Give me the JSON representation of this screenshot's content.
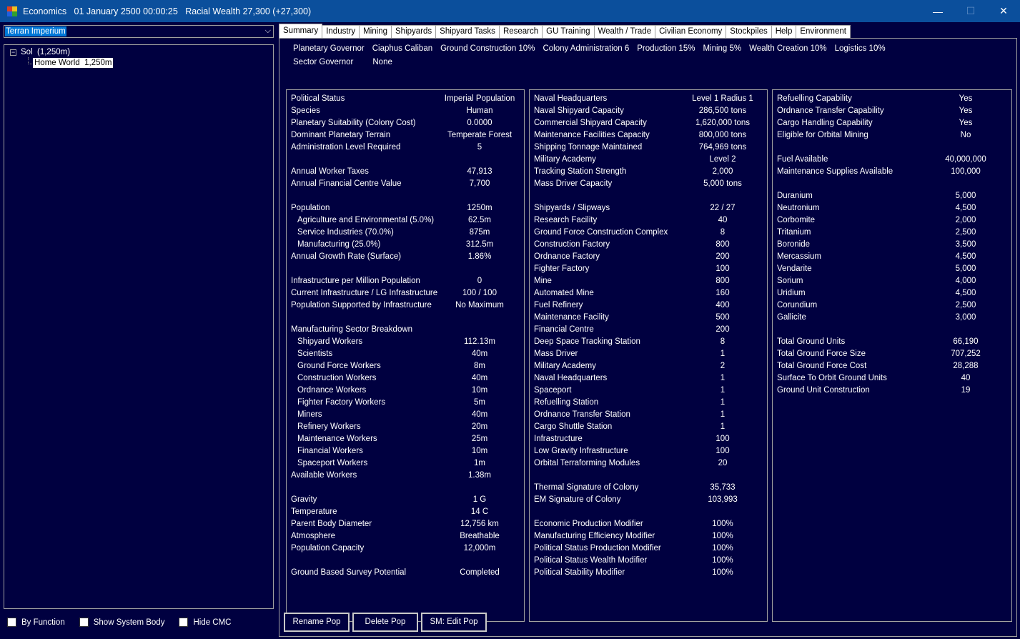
{
  "window": {
    "title": "Economics   01 January 2500 00:00:25   Racial Wealth 27,300 (+27,300)",
    "minimize": "—",
    "maximize": "☐",
    "close": "✕",
    "icon": "app-icon"
  },
  "left": {
    "empire": "Terran Imperium",
    "tree": {
      "system": "Sol  (1,250m)",
      "expander": "−",
      "body": "Home World  1,250m"
    },
    "checkboxes": [
      "By Function",
      "Show System Body",
      "Hide CMC"
    ]
  },
  "tabs": [
    "Summary",
    "Industry",
    "Mining",
    "Shipyards",
    "Shipyard Tasks",
    "Research",
    "GU Training",
    "Wealth / Trade",
    "Civilian Economy",
    "Stockpiles",
    "Help",
    "Environment"
  ],
  "governors": {
    "row1": [
      "Planetary Governor",
      "Ciaphus Caliban",
      "Ground Construction 10%",
      "Colony Administration 6",
      "Production 15%",
      "Mining 5%",
      "Wealth Creation 10%",
      "Logistics 10%"
    ],
    "row2": [
      "Sector Governor",
      "None"
    ]
  },
  "col1": [
    {
      "label": "Political Status",
      "value": "Imperial Population"
    },
    {
      "label": "Species",
      "value": "Human"
    },
    {
      "label": "Planetary Suitability (Colony Cost)",
      "value": "0.0000"
    },
    {
      "label": "Dominant Planetary Terrain",
      "value": "Temperate Forest"
    },
    {
      "label": "Administration Level Required",
      "value": "5"
    },
    {
      "label": "",
      "value": ""
    },
    {
      "label": "Annual Worker Taxes",
      "value": "47,913"
    },
    {
      "label": "Annual Financial Centre Value",
      "value": "7,700"
    },
    {
      "label": "",
      "value": ""
    },
    {
      "label": "Population",
      "value": "1250m"
    },
    {
      "label": "Agriculture and Environmental (5.0%)",
      "value": "62.5m",
      "indent": true
    },
    {
      "label": "Service Industries (70.0%)",
      "value": "875m",
      "indent": true
    },
    {
      "label": "Manufacturing (25.0%)",
      "value": "312.5m",
      "indent": true
    },
    {
      "label": "Annual Growth Rate (Surface)",
      "value": "1.86%"
    },
    {
      "label": "",
      "value": ""
    },
    {
      "label": "Infrastructure per Million Population",
      "value": "0"
    },
    {
      "label": "Current Infrastructure / LG Infrastructure",
      "value": "100 / 100"
    },
    {
      "label": "Population Supported by Infrastructure",
      "value": "No Maximum"
    },
    {
      "label": "",
      "value": ""
    },
    {
      "label": "Manufacturing Sector Breakdown",
      "value": ""
    },
    {
      "label": "Shipyard Workers",
      "value": "112.13m",
      "indent": true
    },
    {
      "label": "Scientists",
      "value": "40m",
      "indent": true
    },
    {
      "label": "Ground Force Workers",
      "value": "8m",
      "indent": true
    },
    {
      "label": "Construction Workers",
      "value": "40m",
      "indent": true
    },
    {
      "label": "Ordnance Workers",
      "value": "10m",
      "indent": true
    },
    {
      "label": "Fighter Factory Workers",
      "value": "5m",
      "indent": true
    },
    {
      "label": "Miners",
      "value": "40m",
      "indent": true
    },
    {
      "label": "Refinery Workers",
      "value": "20m",
      "indent": true
    },
    {
      "label": "Maintenance Workers",
      "value": "25m",
      "indent": true
    },
    {
      "label": "Financial Workers",
      "value": "10m",
      "indent": true
    },
    {
      "label": "Spaceport Workers",
      "value": "1m",
      "indent": true
    },
    {
      "label": "Available Workers",
      "value": "1.38m"
    },
    {
      "label": "",
      "value": ""
    },
    {
      "label": "Gravity",
      "value": "1 G"
    },
    {
      "label": "Temperature",
      "value": "14 C"
    },
    {
      "label": "Parent Body Diameter",
      "value": "12,756 km"
    },
    {
      "label": "Atmosphere",
      "value": "Breathable"
    },
    {
      "label": "Population Capacity",
      "value": "12,000m"
    },
    {
      "label": "",
      "value": ""
    },
    {
      "label": "Ground Based Survey Potential",
      "value": "Completed"
    }
  ],
  "col2": [
    {
      "label": "Naval Headquarters",
      "value": "Level 1  Radius 1"
    },
    {
      "label": "Naval Shipyard Capacity",
      "value": "286,500 tons"
    },
    {
      "label": "Commercial Shipyard Capacity",
      "value": "1,620,000 tons"
    },
    {
      "label": "Maintenance Facilities Capacity",
      "value": "800,000 tons"
    },
    {
      "label": "Shipping Tonnage Maintained",
      "value": "764,969 tons"
    },
    {
      "label": "Military Academy",
      "value": "Level 2"
    },
    {
      "label": "Tracking Station Strength",
      "value": "2,000"
    },
    {
      "label": "Mass Driver Capacity",
      "value": "5,000 tons"
    },
    {
      "label": "",
      "value": ""
    },
    {
      "label": "Shipyards / Slipways",
      "value": "22 / 27"
    },
    {
      "label": "Research Facility",
      "value": "40"
    },
    {
      "label": "Ground Force Construction Complex",
      "value": "8"
    },
    {
      "label": "Construction Factory",
      "value": "800"
    },
    {
      "label": "Ordnance Factory",
      "value": "200"
    },
    {
      "label": "Fighter Factory",
      "value": "100"
    },
    {
      "label": "Mine",
      "value": "800"
    },
    {
      "label": "Automated Mine",
      "value": "160"
    },
    {
      "label": "Fuel Refinery",
      "value": "400"
    },
    {
      "label": "Maintenance Facility",
      "value": "500"
    },
    {
      "label": "Financial Centre",
      "value": "200"
    },
    {
      "label": "Deep Space Tracking Station",
      "value": "8"
    },
    {
      "label": "Mass Driver",
      "value": "1"
    },
    {
      "label": "Military Academy",
      "value": "2"
    },
    {
      "label": "Naval Headquarters",
      "value": "1"
    },
    {
      "label": "Spaceport",
      "value": "1"
    },
    {
      "label": "Refuelling Station",
      "value": "1"
    },
    {
      "label": "Ordnance Transfer Station",
      "value": "1"
    },
    {
      "label": "Cargo Shuttle Station",
      "value": "1"
    },
    {
      "label": "Infrastructure",
      "value": "100"
    },
    {
      "label": "Low Gravity Infrastructure",
      "value": "100"
    },
    {
      "label": "Orbital Terraforming Modules",
      "value": "20"
    },
    {
      "label": "",
      "value": ""
    },
    {
      "label": "Thermal Signature of Colony",
      "value": "35,733"
    },
    {
      "label": "EM Signature of Colony",
      "value": "103,993"
    },
    {
      "label": "",
      "value": ""
    },
    {
      "label": "Economic Production Modifier",
      "value": "100%"
    },
    {
      "label": "Manufacturing Efficiency Modifier",
      "value": "100%"
    },
    {
      "label": "Political Status Production Modifier",
      "value": "100%"
    },
    {
      "label": "Political Status Wealth Modifier",
      "value": "100%"
    },
    {
      "label": "Political Stability Modifier",
      "value": "100%"
    }
  ],
  "col3": [
    {
      "label": "Refuelling Capability",
      "value": "Yes"
    },
    {
      "label": "Ordnance Transfer Capability",
      "value": "Yes"
    },
    {
      "label": "Cargo Handling Capability",
      "value": "Yes"
    },
    {
      "label": "Eligible for Orbital Mining",
      "value": "No"
    },
    {
      "label": "",
      "value": ""
    },
    {
      "label": "Fuel Available",
      "value": "40,000,000"
    },
    {
      "label": "Maintenance Supplies Available",
      "value": "100,000"
    },
    {
      "label": "",
      "value": ""
    },
    {
      "label": "Duranium",
      "value": "5,000"
    },
    {
      "label": "Neutronium",
      "value": "4,500"
    },
    {
      "label": "Corbomite",
      "value": "2,000"
    },
    {
      "label": "Tritanium",
      "value": "2,500"
    },
    {
      "label": "Boronide",
      "value": "3,500"
    },
    {
      "label": "Mercassium",
      "value": "4,500"
    },
    {
      "label": "Vendarite",
      "value": "5,000"
    },
    {
      "label": "Sorium",
      "value": "4,000"
    },
    {
      "label": "Uridium",
      "value": "4,500"
    },
    {
      "label": "Corundium",
      "value": "2,500"
    },
    {
      "label": "Gallicite",
      "value": "3,000"
    },
    {
      "label": "",
      "value": ""
    },
    {
      "label": "Total Ground Units",
      "value": "66,190"
    },
    {
      "label": "Total Ground Force Size",
      "value": "707,252"
    },
    {
      "label": "Total Ground Force Cost",
      "value": "28,288"
    },
    {
      "label": "Surface To Orbit Ground Units",
      "value": "40"
    },
    {
      "label": "Ground Unit Construction",
      "value": "19"
    }
  ],
  "buttons": [
    "Rename Pop",
    "Delete Pop",
    "SM: Edit Pop"
  ]
}
